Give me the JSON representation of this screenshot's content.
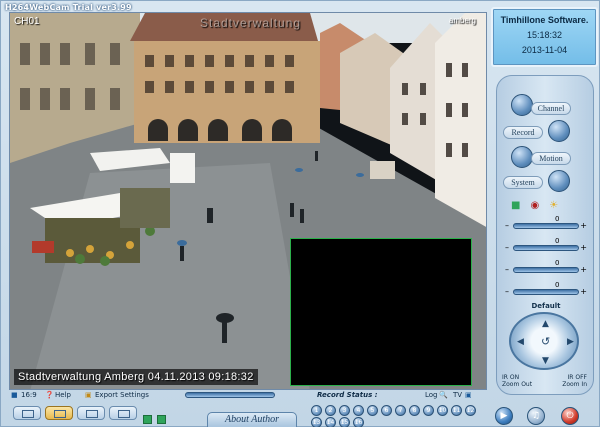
{
  "app": {
    "title": "H264WebCam Trial ver3.99"
  },
  "video": {
    "channel": "CH01",
    "watermark": "Stadtverwaltung",
    "top_right": "amberg",
    "stamp": "Stadtverwaltung Amberg  04.11.2013 09:18:32"
  },
  "info": {
    "line1": "Timhillone Software.",
    "line2": "15:18:32",
    "line3": "2013-11-04"
  },
  "controls": {
    "channel": "Channel",
    "record": "Record",
    "motion": "Motion",
    "system": "System",
    "sliders": [
      {
        "value": "0"
      },
      {
        "value": "0"
      },
      {
        "value": "0"
      },
      {
        "value": "0"
      }
    ],
    "default_label": "Default",
    "ir_on": "IR ON",
    "zoom_out": "Zoom Out",
    "ir_off": "IR OFF",
    "zoom_in": "Zoom In"
  },
  "bottom": {
    "ratio": "16:9",
    "help": "Help",
    "export": "Export Settings",
    "record_status": "Record Status :",
    "log": "Log",
    "tv": "TV",
    "about": "About Author",
    "numbers": [
      "1",
      "2",
      "3",
      "4",
      "5",
      "6",
      "7",
      "8",
      "9",
      "10",
      "11",
      "12",
      "13",
      "14",
      "15",
      "16"
    ]
  },
  "colors": {
    "accent": "#5f8ebd",
    "pip_border": "#2bb04a",
    "info_bg": "#8ccff2"
  }
}
